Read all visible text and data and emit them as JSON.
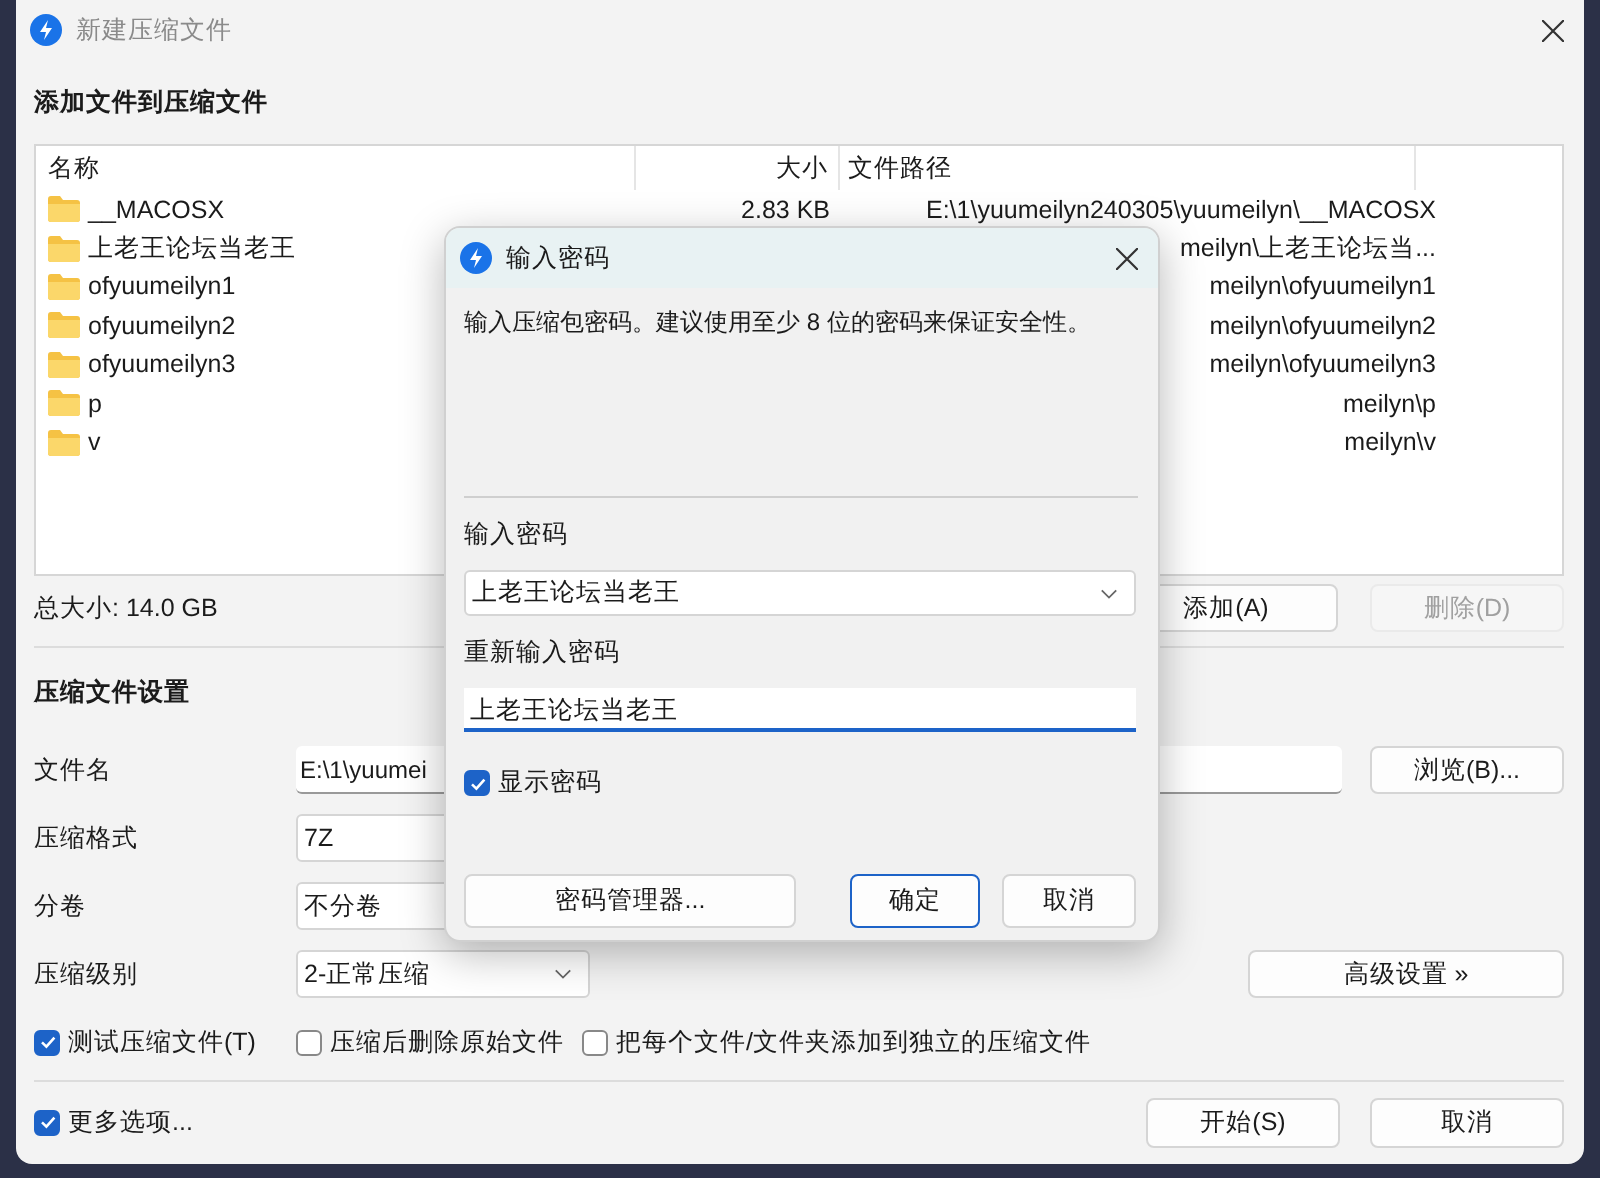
{
  "window": {
    "title": "新建压缩文件"
  },
  "files_section": {
    "heading": "添加文件到压缩文件",
    "columns": [
      "名称",
      "大小",
      "文件路径"
    ],
    "rows": [
      {
        "name": "__MACOSX",
        "size": "2.83 KB",
        "path": "E:\\1\\yuumeilyn240305\\yuumeilyn\\__MACOSX"
      },
      {
        "name": "上老王论坛当老王",
        "path": "meilyn\\上老王论坛当..."
      },
      {
        "name": "ofyuumeilyn1",
        "path": "meilyn\\ofyuumeilyn1"
      },
      {
        "name": "ofyuumeilyn2",
        "path": "meilyn\\ofyuumeilyn2"
      },
      {
        "name": "ofyuumeilyn3",
        "path": "meilyn\\ofyuumeilyn3"
      },
      {
        "name": "p",
        "path": "meilyn\\p"
      },
      {
        "name": "v",
        "path": "meilyn\\v"
      }
    ],
    "total": "总大小: 14.0 GB",
    "add_button": "添加(A)",
    "remove_button": {
      "label": "删除(D)",
      "disabled": true
    }
  },
  "settings": {
    "heading": "压缩文件设置",
    "fields": [
      {
        "kind": "text",
        "label": "文件名",
        "value": "E:\\1\\yuumei",
        "button": "浏览(B)..."
      },
      {
        "kind": "select",
        "label": "压缩格式",
        "value": "7Z"
      },
      {
        "kind": "select",
        "label": "分卷",
        "value": "不分卷"
      },
      {
        "kind": "select",
        "label": "压缩级别",
        "value": "2-正常压缩",
        "button": "高级设置 »"
      }
    ],
    "options": [
      {
        "label": "测试压缩文件(T)",
        "checked": true
      },
      {
        "label": "压缩后删除原始文件",
        "checked": false
      },
      {
        "label": "把每个文件/文件夹添加到独立的压缩文件",
        "checked": false
      }
    ]
  },
  "footer": {
    "more_options": {
      "label": "更多选项...",
      "checked": true
    },
    "buttons": [
      "开始(S)",
      "取消"
    ]
  },
  "dialog": {
    "title": "输入密码",
    "message": "输入压缩包密码。建议使用至少 8 位的密码来保证安全性。",
    "password_label": "输入密码",
    "password": "上老王论坛当老王",
    "confirm_label": "重新输入密码",
    "confirm": "上老王论坛当老王",
    "show_password": {
      "label": "显示密码",
      "checked": true
    },
    "buttons": [
      {
        "label": "密码管理器...",
        "default": false
      },
      {
        "label": "确定",
        "default": true
      },
      {
        "label": "取消",
        "default": false
      }
    ]
  }
}
